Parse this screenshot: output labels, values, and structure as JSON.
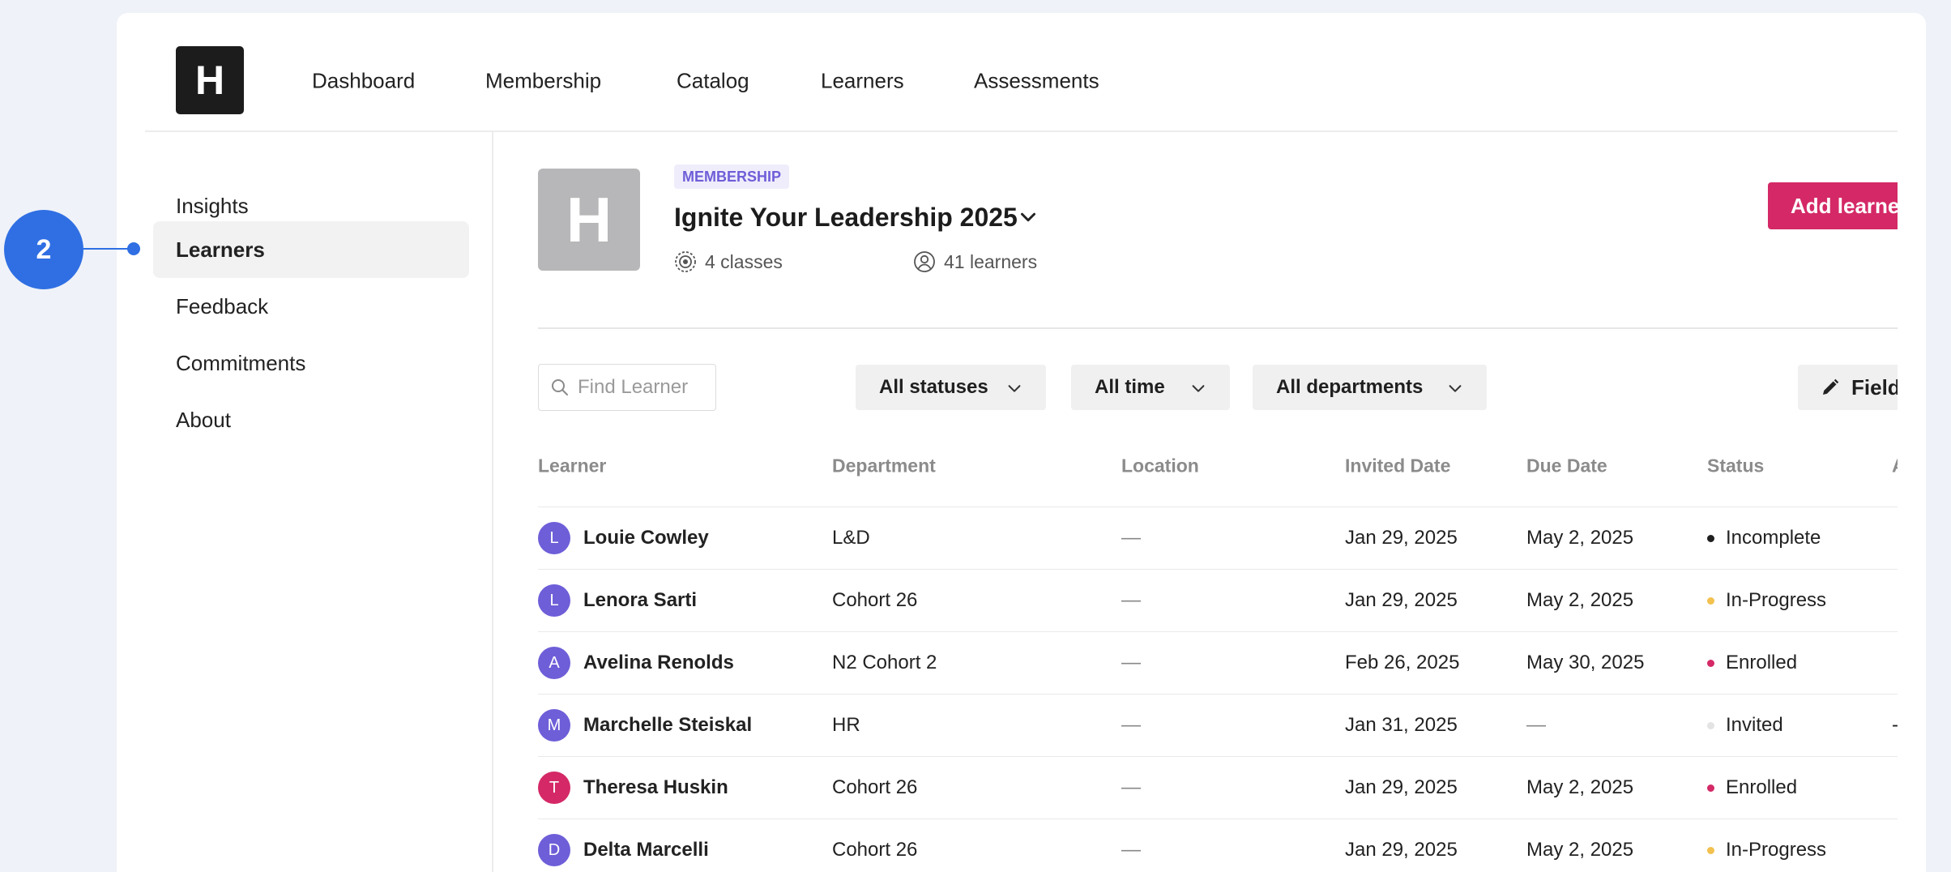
{
  "logo": "H",
  "nav": {
    "items": [
      "Dashboard",
      "Membership",
      "Catalog",
      "Learners",
      "Assessments"
    ]
  },
  "sidebar": {
    "items": [
      "Insights",
      "Learners",
      "Feedback",
      "Commitments",
      "About"
    ],
    "active_index": 1
  },
  "membership": {
    "badge": "MEMBERSHIP",
    "image_letter": "H",
    "title": "Ignite Your Leadership 2025",
    "classes": "4 classes",
    "learners": "41 learners"
  },
  "actions": {
    "add_learner": "Add learner",
    "fields": "Fields"
  },
  "search": {
    "placeholder": "Find Learner",
    "value": ""
  },
  "filters": {
    "status": "All statuses",
    "time": "All time",
    "departments": "All departments"
  },
  "table": {
    "columns": [
      "Learner",
      "Department",
      "Location",
      "Invited Date",
      "Due Date",
      "Status",
      "A"
    ],
    "rows": [
      {
        "initial": "L",
        "avatar_color": "#6e5ed8",
        "name": "Louie Cowley",
        "department": "L&D",
        "location": "—",
        "invited": "Jan 29, 2025",
        "due": "May 2, 2025",
        "status": "Incomplete",
        "status_color": "#1f1f1f",
        "last": ""
      },
      {
        "initial": "L",
        "avatar_color": "#6e5ed8",
        "name": "Lenora Sarti",
        "department": "Cohort 26",
        "location": "—",
        "invited": "Jan 29, 2025",
        "due": "May 2, 2025",
        "status": "In-Progress",
        "status_color": "#f2c14e",
        "last": ""
      },
      {
        "initial": "A",
        "avatar_color": "#6e5ed8",
        "name": "Avelina Renolds",
        "department": "N2 Cohort 2",
        "location": "—",
        "invited": "Feb 26, 2025",
        "due": "May 30, 2025",
        "status": "Enrolled",
        "status_color": "#d42966",
        "last": ""
      },
      {
        "initial": "M",
        "avatar_color": "#6e5ed8",
        "name": "Marchelle Steiskal",
        "department": "HR",
        "location": "—",
        "invited": "Jan 31, 2025",
        "due": "—",
        "status": "Invited",
        "status_color": "#e3e3e3",
        "last": "-"
      },
      {
        "initial": "T",
        "avatar_color": "#d42966",
        "name": "Theresa Huskin",
        "department": "Cohort 26",
        "location": "—",
        "invited": "Jan 29, 2025",
        "due": "May 2, 2025",
        "status": "Enrolled",
        "status_color": "#d42966",
        "last": ""
      },
      {
        "initial": "D",
        "avatar_color": "#6e5ed8",
        "name": "Delta Marcelli",
        "department": "Cohort 26",
        "location": "—",
        "invited": "Jan 29, 2025",
        "due": "May 2, 2025",
        "status": "In-Progress",
        "status_color": "#f2c14e",
        "last": ""
      }
    ]
  },
  "annotation": {
    "label": "2"
  },
  "colors": {
    "accent": "#d42966",
    "purple": "#6e5ed8",
    "annotation": "#2f6fe3"
  }
}
